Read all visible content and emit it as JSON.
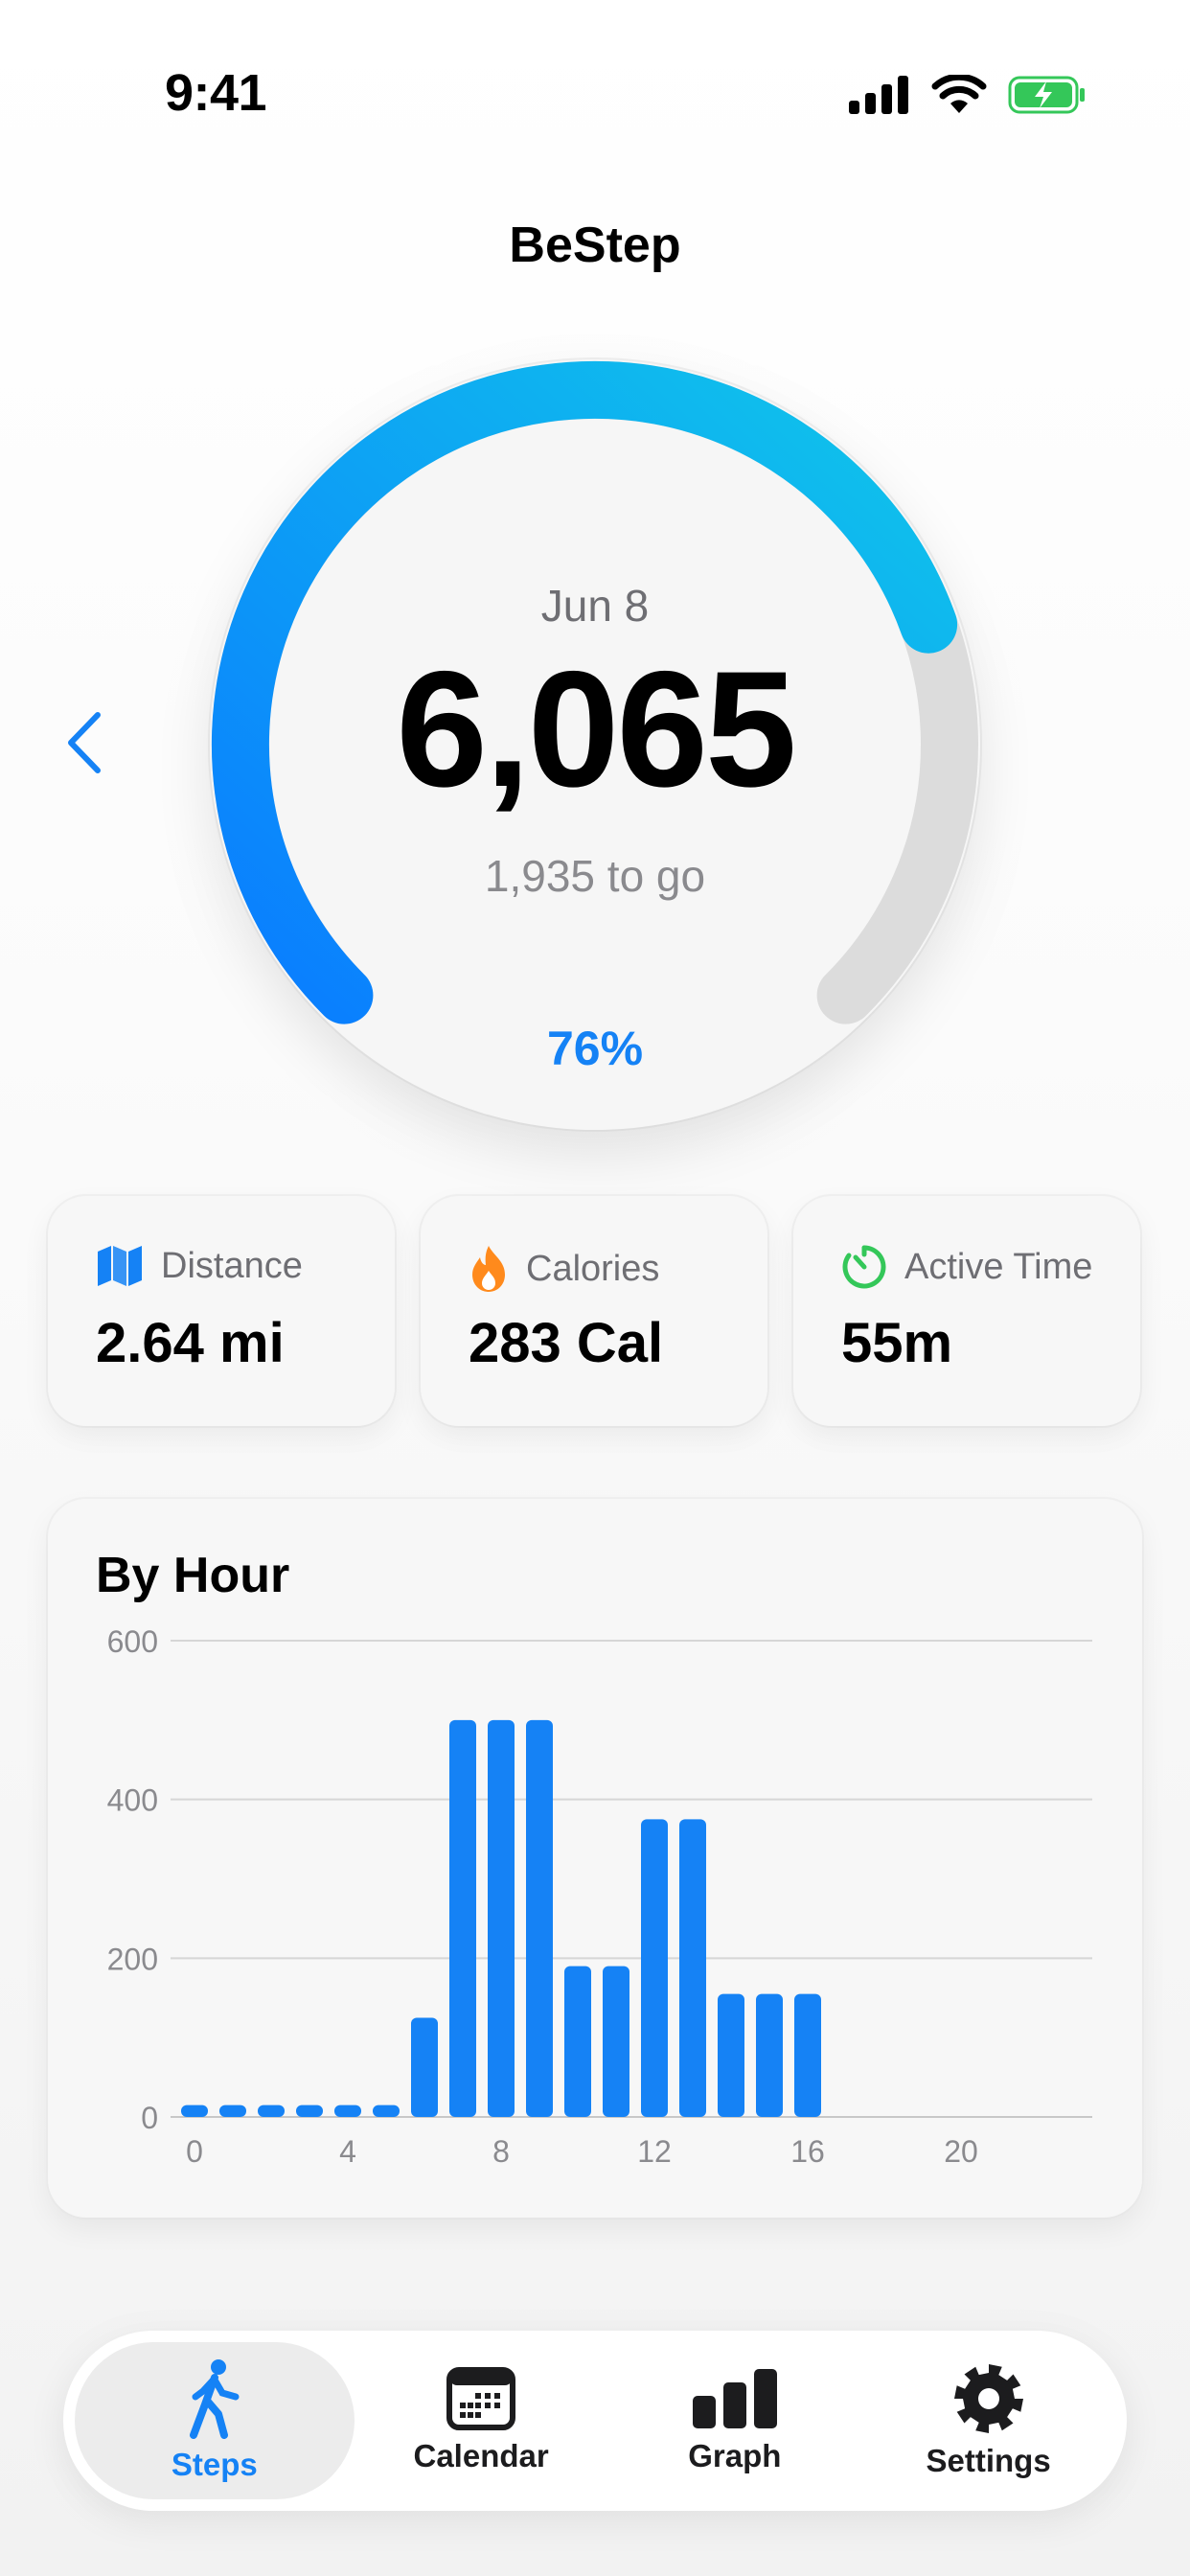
{
  "status": {
    "time": "9:41"
  },
  "app": {
    "title": "BeStep"
  },
  "summary": {
    "date": "Jun 8",
    "steps": "6,065",
    "remaining": "1,935 to go",
    "percent_label": "76%",
    "progress": 0.76
  },
  "stats": [
    {
      "label": "Distance",
      "value": "2.64 mi",
      "icon": "map-icon",
      "color": "#1582f5"
    },
    {
      "label": "Calories",
      "value": "283 Cal",
      "icon": "flame-icon",
      "color": "#ff8a1c"
    },
    {
      "label": "Active Time",
      "value": "55m",
      "icon": "timer-icon",
      "color": "#34c759"
    }
  ],
  "chart": {
    "title": "By Hour"
  },
  "chart_data": {
    "type": "bar",
    "title": "By Hour",
    "x": [
      0,
      1,
      2,
      3,
      4,
      5,
      6,
      7,
      8,
      9,
      10,
      11,
      12,
      13,
      14,
      15,
      16
    ],
    "values": [
      15,
      15,
      15,
      15,
      15,
      15,
      125,
      500,
      500,
      500,
      190,
      190,
      375,
      375,
      155,
      155,
      155
    ],
    "xticks": [
      0,
      4,
      8,
      12,
      16,
      20
    ],
    "yticks": [
      0,
      200,
      400,
      600
    ],
    "xlim": [
      0,
      23
    ],
    "ylim": [
      0,
      600
    ],
    "grid": true,
    "color": "#1582f5"
  },
  "tabs": [
    {
      "label": "Steps",
      "icon": "walking-icon",
      "active": true
    },
    {
      "label": "Calendar",
      "icon": "calendar-icon",
      "active": false
    },
    {
      "label": "Graph",
      "icon": "bar-chart-icon",
      "active": false
    },
    {
      "label": "Settings",
      "icon": "gear-icon",
      "active": false
    }
  ],
  "colors": {
    "accent": "#1582f5",
    "accent_light": "#10c2ea",
    "track": "#dcdcdc"
  }
}
